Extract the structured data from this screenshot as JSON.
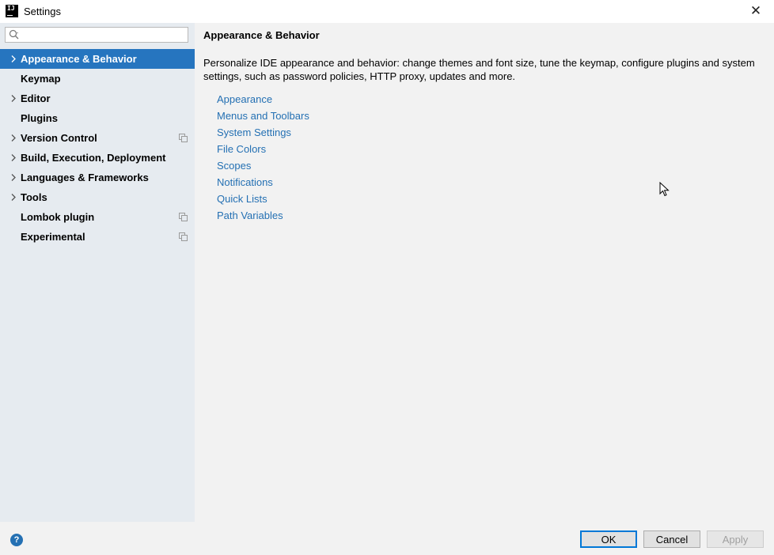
{
  "window": {
    "title": "Settings",
    "app_icon_text": "IJ",
    "close_glyph": "✕"
  },
  "search": {
    "value": "",
    "placeholder": ""
  },
  "sidebar": {
    "items": [
      {
        "label": "Appearance & Behavior",
        "expandable": true,
        "selected": true,
        "project_icon": false
      },
      {
        "label": "Keymap",
        "expandable": false,
        "selected": false,
        "project_icon": false
      },
      {
        "label": "Editor",
        "expandable": true,
        "selected": false,
        "project_icon": false
      },
      {
        "label": "Plugins",
        "expandable": false,
        "selected": false,
        "project_icon": false
      },
      {
        "label": "Version Control",
        "expandable": true,
        "selected": false,
        "project_icon": true
      },
      {
        "label": "Build, Execution, Deployment",
        "expandable": true,
        "selected": false,
        "project_icon": false
      },
      {
        "label": "Languages & Frameworks",
        "expandable": true,
        "selected": false,
        "project_icon": false
      },
      {
        "label": "Tools",
        "expandable": true,
        "selected": false,
        "project_icon": false
      },
      {
        "label": "Lombok plugin",
        "expandable": false,
        "selected": false,
        "project_icon": true
      },
      {
        "label": "Experimental",
        "expandable": false,
        "selected": false,
        "project_icon": true
      }
    ]
  },
  "main": {
    "title": "Appearance & Behavior",
    "description": "Personalize IDE appearance and behavior: change themes and font size, tune the keymap, configure plugins and system settings, such as password policies, HTTP proxy, updates and more.",
    "links": [
      "Appearance",
      "Menus and Toolbars",
      "System Settings",
      "File Colors",
      "Scopes",
      "Notifications",
      "Quick Lists",
      "Path Variables"
    ]
  },
  "footer": {
    "help_glyph": "?",
    "ok_label": "OK",
    "cancel_label": "Cancel",
    "apply_label": "Apply"
  },
  "colors": {
    "selection": "#2675bf",
    "link": "#2470b3",
    "sidebar_bg": "#e6ebf0"
  }
}
